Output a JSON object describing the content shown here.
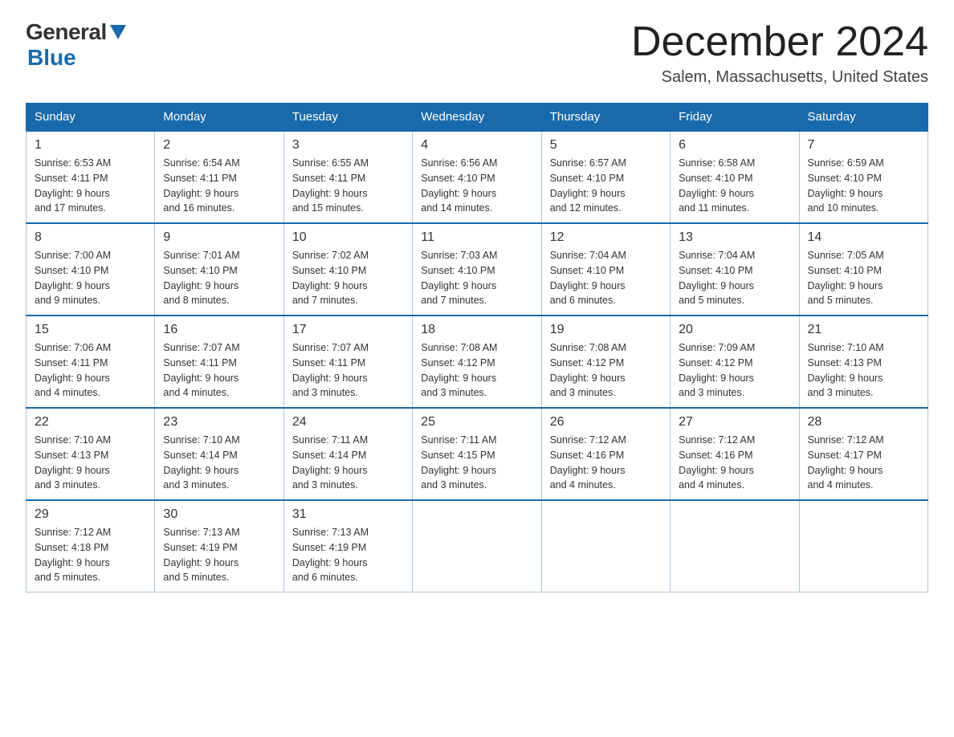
{
  "header": {
    "logo_general": "General",
    "logo_blue": "Blue",
    "month_title": "December 2024",
    "location": "Salem, Massachusetts, United States"
  },
  "days_of_week": [
    "Sunday",
    "Monday",
    "Tuesday",
    "Wednesday",
    "Thursday",
    "Friday",
    "Saturday"
  ],
  "weeks": [
    [
      {
        "day": "1",
        "info": "Sunrise: 6:53 AM\nSunset: 4:11 PM\nDaylight: 9 hours\nand 17 minutes."
      },
      {
        "day": "2",
        "info": "Sunrise: 6:54 AM\nSunset: 4:11 PM\nDaylight: 9 hours\nand 16 minutes."
      },
      {
        "day": "3",
        "info": "Sunrise: 6:55 AM\nSunset: 4:11 PM\nDaylight: 9 hours\nand 15 minutes."
      },
      {
        "day": "4",
        "info": "Sunrise: 6:56 AM\nSunset: 4:10 PM\nDaylight: 9 hours\nand 14 minutes."
      },
      {
        "day": "5",
        "info": "Sunrise: 6:57 AM\nSunset: 4:10 PM\nDaylight: 9 hours\nand 12 minutes."
      },
      {
        "day": "6",
        "info": "Sunrise: 6:58 AM\nSunset: 4:10 PM\nDaylight: 9 hours\nand 11 minutes."
      },
      {
        "day": "7",
        "info": "Sunrise: 6:59 AM\nSunset: 4:10 PM\nDaylight: 9 hours\nand 10 minutes."
      }
    ],
    [
      {
        "day": "8",
        "info": "Sunrise: 7:00 AM\nSunset: 4:10 PM\nDaylight: 9 hours\nand 9 minutes."
      },
      {
        "day": "9",
        "info": "Sunrise: 7:01 AM\nSunset: 4:10 PM\nDaylight: 9 hours\nand 8 minutes."
      },
      {
        "day": "10",
        "info": "Sunrise: 7:02 AM\nSunset: 4:10 PM\nDaylight: 9 hours\nand 7 minutes."
      },
      {
        "day": "11",
        "info": "Sunrise: 7:03 AM\nSunset: 4:10 PM\nDaylight: 9 hours\nand 7 minutes."
      },
      {
        "day": "12",
        "info": "Sunrise: 7:04 AM\nSunset: 4:10 PM\nDaylight: 9 hours\nand 6 minutes."
      },
      {
        "day": "13",
        "info": "Sunrise: 7:04 AM\nSunset: 4:10 PM\nDaylight: 9 hours\nand 5 minutes."
      },
      {
        "day": "14",
        "info": "Sunrise: 7:05 AM\nSunset: 4:10 PM\nDaylight: 9 hours\nand 5 minutes."
      }
    ],
    [
      {
        "day": "15",
        "info": "Sunrise: 7:06 AM\nSunset: 4:11 PM\nDaylight: 9 hours\nand 4 minutes."
      },
      {
        "day": "16",
        "info": "Sunrise: 7:07 AM\nSunset: 4:11 PM\nDaylight: 9 hours\nand 4 minutes."
      },
      {
        "day": "17",
        "info": "Sunrise: 7:07 AM\nSunset: 4:11 PM\nDaylight: 9 hours\nand 3 minutes."
      },
      {
        "day": "18",
        "info": "Sunrise: 7:08 AM\nSunset: 4:12 PM\nDaylight: 9 hours\nand 3 minutes."
      },
      {
        "day": "19",
        "info": "Sunrise: 7:08 AM\nSunset: 4:12 PM\nDaylight: 9 hours\nand 3 minutes."
      },
      {
        "day": "20",
        "info": "Sunrise: 7:09 AM\nSunset: 4:12 PM\nDaylight: 9 hours\nand 3 minutes."
      },
      {
        "day": "21",
        "info": "Sunrise: 7:10 AM\nSunset: 4:13 PM\nDaylight: 9 hours\nand 3 minutes."
      }
    ],
    [
      {
        "day": "22",
        "info": "Sunrise: 7:10 AM\nSunset: 4:13 PM\nDaylight: 9 hours\nand 3 minutes."
      },
      {
        "day": "23",
        "info": "Sunrise: 7:10 AM\nSunset: 4:14 PM\nDaylight: 9 hours\nand 3 minutes."
      },
      {
        "day": "24",
        "info": "Sunrise: 7:11 AM\nSunset: 4:14 PM\nDaylight: 9 hours\nand 3 minutes."
      },
      {
        "day": "25",
        "info": "Sunrise: 7:11 AM\nSunset: 4:15 PM\nDaylight: 9 hours\nand 3 minutes."
      },
      {
        "day": "26",
        "info": "Sunrise: 7:12 AM\nSunset: 4:16 PM\nDaylight: 9 hours\nand 4 minutes."
      },
      {
        "day": "27",
        "info": "Sunrise: 7:12 AM\nSunset: 4:16 PM\nDaylight: 9 hours\nand 4 minutes."
      },
      {
        "day": "28",
        "info": "Sunrise: 7:12 AM\nSunset: 4:17 PM\nDaylight: 9 hours\nand 4 minutes."
      }
    ],
    [
      {
        "day": "29",
        "info": "Sunrise: 7:12 AM\nSunset: 4:18 PM\nDaylight: 9 hours\nand 5 minutes."
      },
      {
        "day": "30",
        "info": "Sunrise: 7:13 AM\nSunset: 4:19 PM\nDaylight: 9 hours\nand 5 minutes."
      },
      {
        "day": "31",
        "info": "Sunrise: 7:13 AM\nSunset: 4:19 PM\nDaylight: 9 hours\nand 6 minutes."
      },
      {
        "day": "",
        "info": ""
      },
      {
        "day": "",
        "info": ""
      },
      {
        "day": "",
        "info": ""
      },
      {
        "day": "",
        "info": ""
      }
    ]
  ]
}
